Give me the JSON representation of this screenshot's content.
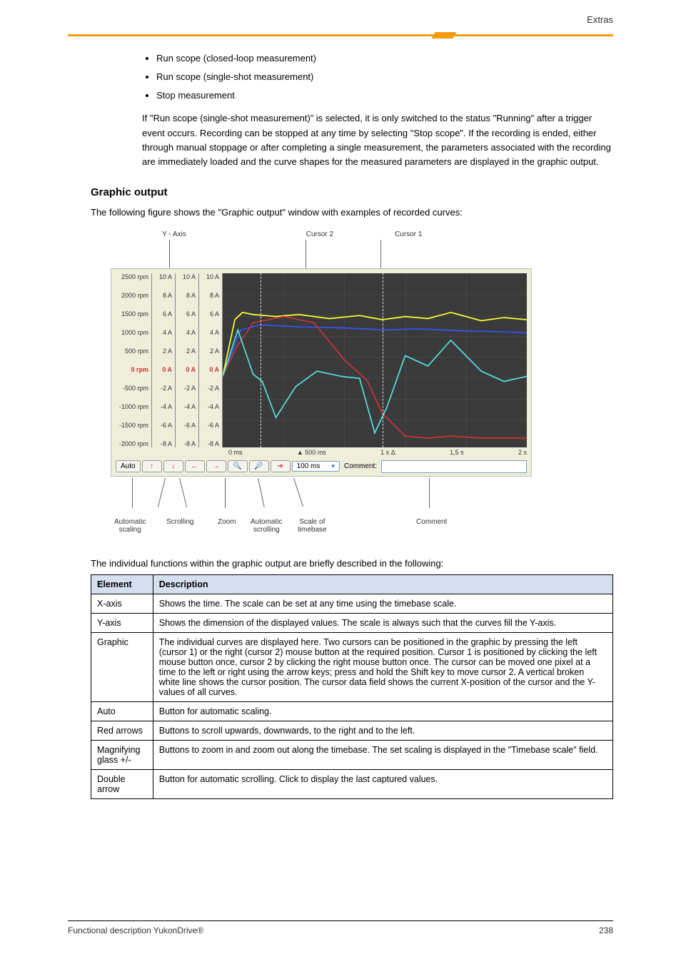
{
  "header_right": "Extras",
  "bullets": [
    "Run scope (closed-loop measurement)",
    "Run scope (single-shot measurement)",
    "Stop measurement"
  ],
  "paragraphs": {
    "p1": "If \"Run scope (single-shot measurement)” is selected, it is only switched to the status \"Running\" after a trigger event occurs. Recording can be stopped at any time by selecting \"Stop scope\". If the recording is ended, either through manual stoppage or after completing a single measurement, the parameters associated with the recording are immediately loaded and the curve shapes for the measured parameters are displayed in the graphic output.",
    "p2": "The following figure shows the \"Graphic output\" window with examples of recorded curves:",
    "p3_below_fig": "The individual functions within the graphic output are briefly described in the following:"
  },
  "section_heading": "Graphic output",
  "figure": {
    "annot_top": {
      "yaxis": "Y - Axis",
      "cursor2": "Cursor 2",
      "cursor1": "Cursor 1"
    },
    "ycol_rpm": [
      "2500 rpm",
      "2000 rpm",
      "1500 rpm",
      "1000 rpm",
      "500 rpm",
      "0 rpm",
      "-500 rpm",
      "-1000 rpm",
      "-1500 rpm",
      "-2000 rpm"
    ],
    "ycol_amp": [
      "10 A",
      "8 A",
      "6 A",
      "4 A",
      "2 A",
      "0 A",
      "-2 A",
      "-4 A",
      "-6 A",
      "-8 A"
    ],
    "xticks": [
      "0 ms",
      "500 ms",
      "1 s",
      "1,5 s",
      "2 s"
    ],
    "delta": "Δ",
    "toolbar": {
      "auto": "Auto",
      "up": "↑",
      "down": "↓",
      "left": "←",
      "right": "→",
      "zoom_in": "�🔍+",
      "zoom_out": "🔍−",
      "run": "→",
      "timebase": "100 ms",
      "comment_label": "Comment:"
    },
    "annot_bot": {
      "autoscale": "Automatic\nscaling",
      "scroll": "Scrolling",
      "zoom": "Zoom",
      "autoscroll": "Automatic\nscrolling",
      "timebase": "Scale of\ntimebase",
      "comment": "Comment"
    }
  },
  "table": {
    "head": [
      "Element",
      "Description"
    ],
    "rows": [
      [
        "X-axis",
        "Shows the time. The scale can be set at any time using the timebase scale."
      ],
      [
        "Y-axis",
        "Shows the dimension of the displayed values. The scale is always such that the curves fill the Y-axis."
      ],
      [
        "Graphic",
        "The individual curves are displayed here. Two cursors can be positioned in the graphic by pressing the left (cursor 1) or the right (cursor 2) mouse button at the required position. Cursor 1 is positioned by clicking the left mouse button once, cursor 2 by clicking the right mouse button once. The cursor can be moved one pixel at a time to the left or right using the arrow keys; press and hold the Shift key to move cursor 2. A vertical broken white line shows the cursor position. The cursor data field shows the current X-position of the cursor and the Y-values of all curves."
      ],
      [
        "Auto",
        "Button for automatic scaling."
      ],
      [
        "Red arrows",
        "Buttons to scroll upwards, downwards, to the right and to the left."
      ],
      [
        "Magnifying glass +/-",
        "Buttons to zoom in and zoom out along the timebase. The set scaling is displayed in the \"Timebase scale\" field."
      ],
      [
        "Double arrow",
        "Button for automatic scrolling. Click to display the last captured values."
      ]
    ]
  },
  "footer": {
    "left": "Functional description YukonDrive®",
    "right": "238"
  },
  "chart_data": {
    "type": "line",
    "title": "Scope graphic output (example)",
    "x_unit": "ms",
    "xlim": [
      0,
      2000
    ],
    "xticks_ms": [
      0,
      500,
      1000,
      1500,
      2000
    ],
    "y_axes": [
      {
        "unit": "rpm",
        "lim": [
          -2000,
          2500
        ],
        "ticks": [
          2500,
          2000,
          1500,
          1000,
          500,
          0,
          -500,
          -1000,
          -1500,
          -2000
        ]
      },
      {
        "unit": "A",
        "lim": [
          -8,
          10
        ],
        "ticks": [
          10,
          8,
          6,
          4,
          2,
          0,
          -2,
          -4,
          -6,
          -8
        ]
      }
    ],
    "cursors_ms": {
      "cursor2": 250,
      "cursor1": 1050
    },
    "series": [
      {
        "name": "Yellow (A)",
        "color": "#ffff33",
        "unit": "A",
        "x_ms": [
          0,
          80,
          130,
          200,
          350,
          500,
          700,
          900,
          1050,
          1200,
          1350,
          1500,
          1700,
          1850,
          2000
        ],
        "values": [
          0,
          5.5,
          6.2,
          6.0,
          5.8,
          6.0,
          5.6,
          5.9,
          5.5,
          5.8,
          5.6,
          6.2,
          5.4,
          5.7,
          5.5
        ]
      },
      {
        "name": "Blue (A)",
        "color": "#3355ff",
        "unit": "A",
        "x_ms": [
          0,
          120,
          250,
          500,
          800,
          1050,
          1300,
          1600,
          1900,
          2000
        ],
        "values": [
          0,
          4.5,
          5.0,
          4.8,
          4.7,
          4.5,
          4.6,
          4.4,
          4.3,
          4.2
        ]
      },
      {
        "name": "Red (rpm)",
        "color": "#cc3333",
        "unit": "rpm",
        "x_ms": [
          0,
          90,
          200,
          400,
          600,
          800,
          950,
          1050,
          1200,
          1350,
          1500,
          1700,
          2000
        ],
        "values": [
          0,
          700,
          1300,
          1450,
          1300,
          400,
          -100,
          -900,
          -1450,
          -1500,
          -1450,
          -1500,
          -1500
        ]
      },
      {
        "name": "Cyan (A)",
        "color": "#55e0e0",
        "unit": "A",
        "x_ms": [
          0,
          100,
          200,
          260,
          350,
          480,
          620,
          780,
          900,
          1000,
          1080,
          1200,
          1350,
          1500,
          1700,
          1850,
          2000
        ],
        "values": [
          0,
          4.5,
          0.2,
          -0.5,
          -4.0,
          -1.0,
          0.5,
          0.0,
          -0.2,
          -5.5,
          -3.0,
          2.0,
          1.0,
          3.5,
          0.5,
          -0.5,
          0.0
        ]
      }
    ]
  }
}
